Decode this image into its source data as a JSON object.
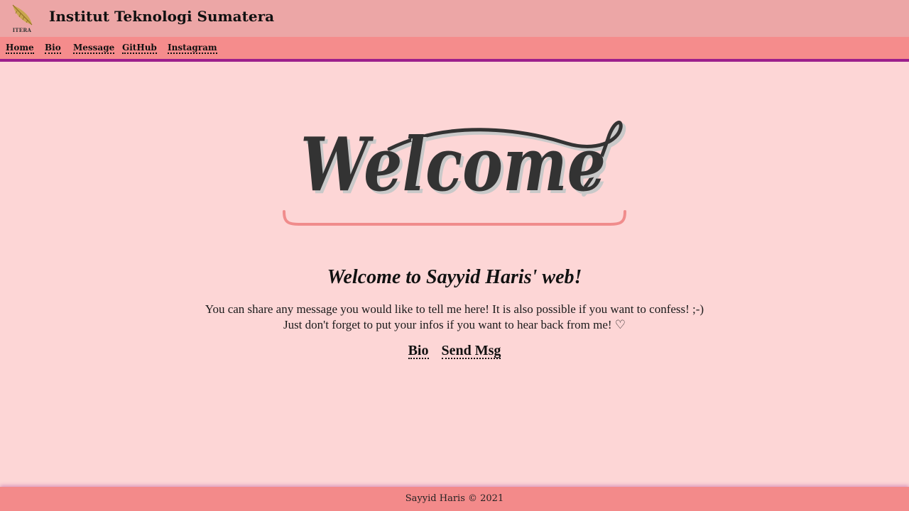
{
  "header": {
    "logo_text": "ITERA",
    "title": "Institut Teknologi Sumatera"
  },
  "nav": {
    "items": [
      {
        "label": "Home"
      },
      {
        "label": "Bio"
      },
      {
        "label": "Message"
      },
      {
        "label": "GitHub"
      },
      {
        "label": "Instagram"
      }
    ]
  },
  "hero": {
    "graphic_text": "Welcome",
    "heading": "Welcome to Sayyid Haris' web!",
    "intro_line1": "You can share any message you would like to tell me here! It is also possible if you want to confess! ;-)",
    "intro_line2": "Just don't forget to put your infos if you want to hear back from me! ♡",
    "links": [
      {
        "label": "Bio"
      },
      {
        "label": "Send Msg"
      }
    ]
  },
  "footer": {
    "text": "Sayyid Haris © 2021"
  },
  "colors": {
    "page_bg": "#fdd6d6",
    "header_bg": "#eca6a6",
    "nav_bg": "#f58c8c",
    "nav_border": "#9c1f8c",
    "footer_bg": "#f38a8a",
    "accent_underline": "#f08c8c"
  }
}
